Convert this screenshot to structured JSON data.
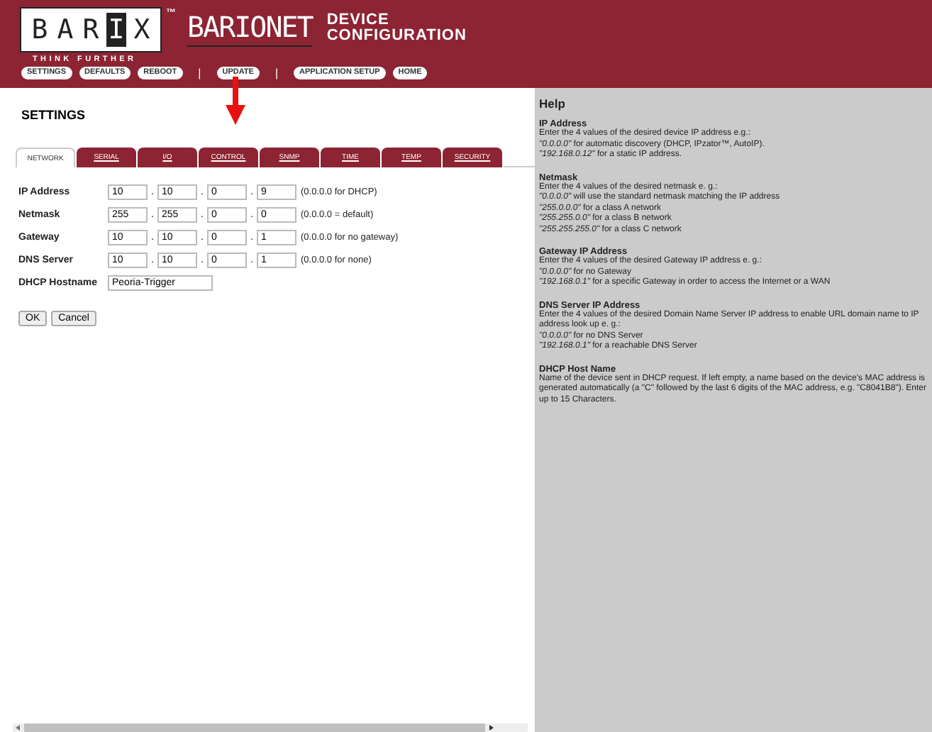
{
  "header": {
    "logo_letters": [
      "B",
      "A",
      "R",
      "I",
      "X"
    ],
    "logo_dark": [
      false,
      false,
      false,
      true,
      false
    ],
    "trademark": "™",
    "product": "BARIONET",
    "title_lines": [
      "DEVICE",
      "CONFIGURATION"
    ],
    "tagline": "THINK FURTHER",
    "nav": [
      {
        "kind": "button",
        "label": "SETTINGS"
      },
      {
        "kind": "button",
        "label": "DEFAULTS"
      },
      {
        "kind": "button",
        "label": "REBOOT"
      },
      {
        "kind": "separator",
        "label": "|"
      },
      {
        "kind": "button",
        "label": "UPDATE"
      },
      {
        "kind": "separator",
        "label": "|"
      },
      {
        "kind": "button",
        "label": "APPLICATION SETUP"
      },
      {
        "kind": "button",
        "label": "HOME"
      }
    ]
  },
  "page_title": "SETTINGS",
  "tabs": [
    {
      "label": "NETWORK",
      "selected": true
    },
    {
      "label": "SERIAL",
      "selected": false
    },
    {
      "label": "I/O",
      "selected": false
    },
    {
      "label": "CONTROL",
      "selected": false
    },
    {
      "label": "SNMP",
      "selected": false
    },
    {
      "label": "TIME",
      "selected": false
    },
    {
      "label": "TEMP",
      "selected": false
    },
    {
      "label": "SECURITY",
      "selected": false
    }
  ],
  "fields": [
    {
      "kind": "ip",
      "label": "IP Address",
      "values": [
        "10",
        "10",
        "0",
        "9"
      ],
      "hint": "(0.0.0.0 for DHCP)"
    },
    {
      "kind": "ip",
      "label": "Netmask",
      "values": [
        "255",
        "255",
        "0",
        "0"
      ],
      "hint": "(0.0.0.0 = default)"
    },
    {
      "kind": "ip",
      "label": "Gateway",
      "values": [
        "10",
        "10",
        "0",
        "1"
      ],
      "hint": "(0.0.0.0 for no gateway)"
    },
    {
      "kind": "ip",
      "label": "DNS Server",
      "values": [
        "10",
        "10",
        "0",
        "1"
      ],
      "hint": "(0.0.0.0 for none)"
    },
    {
      "kind": "text",
      "label": "DHCP Hostname",
      "value": "Peoria-Trigger"
    }
  ],
  "separator": ".",
  "buttons": [
    "OK",
    "Cancel"
  ],
  "help": {
    "title": "Help",
    "sections": [
      {
        "title": "IP Address",
        "lines": [
          "Enter the 4 values of the desired device IP address e.g.:",
          "*\"0.0.0.0\"* for automatic discovery (DHCP, IPzator™, AutoIP).",
          "*\"192.168.0.12\"* for a static IP address."
        ]
      },
      {
        "title": "Netmask",
        "lines": [
          "Enter the 4 values of the desired netmask e. g.:",
          "*\"0.0.0.0\"* will use the standard netmask matching the IP address",
          "*\"255.0.0.0\"* for a class A network",
          "*\"255.255.0.0\"* for a class B network",
          "*\"255.255.255.0\"* for a class C network"
        ]
      },
      {
        "title": "Gateway IP Address",
        "lines": [
          "Enter the 4 values of the desired Gateway IP address e. g.:",
          "*\"0.0.0.0\"* for no Gateway",
          "*\"192.168.0.1\"* for a specific Gateway in order to access the Internet or a WAN"
        ]
      },
      {
        "title": "DNS Server IP Address",
        "lines": [
          "Enter the 4 values of the desired Domain Name Server IP address to enable URL domain name to IP address look up e. g.:",
          "*\"0.0.0.0\"* for no DNS Server",
          "*\"192.168.0.1\"* for a reachable DNS Server"
        ]
      },
      {
        "title": "DHCP Host Name",
        "lines": [
          "Name of the device sent in DHCP request. If left empty, a name based on the device's MAC address is generated automatically (a \"C\" followed by the last 6 digits of the MAC address, e.g. \"C8041B8\"). Enter up to 15 Characters."
        ]
      }
    ]
  }
}
